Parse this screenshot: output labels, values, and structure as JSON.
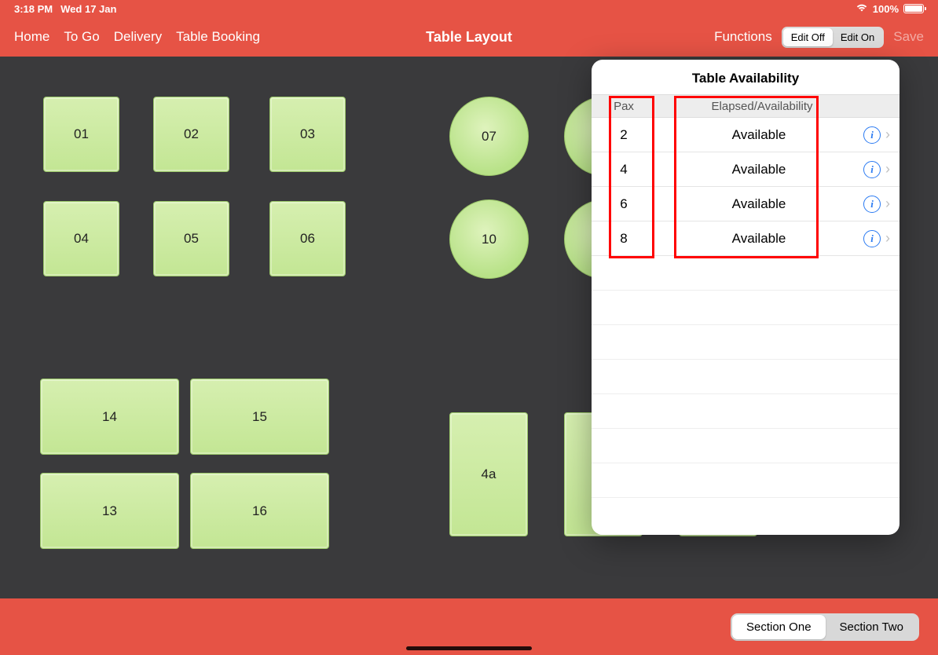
{
  "status": {
    "time": "3:18 PM",
    "date": "Wed 17 Jan",
    "battery": "100%"
  },
  "nav": {
    "home": "Home",
    "togo": "To Go",
    "delivery": "Delivery",
    "booking": "Table Booking",
    "title": "Table Layout",
    "functions": "Functions",
    "edit_off": "Edit Off",
    "edit_on": "Edit On",
    "save": "Save"
  },
  "tables": {
    "t01": "01",
    "t02": "02",
    "t03": "03",
    "t04": "04",
    "t05": "05",
    "t06": "06",
    "t07": "07",
    "t10": "10",
    "t14": "14",
    "t15": "15",
    "t13": "13",
    "t16": "16",
    "t4a": "4a"
  },
  "popover": {
    "title": "Table Availability",
    "col_pax": "Pax",
    "col_status": "Elapsed/Availability",
    "rows": [
      {
        "pax": "2",
        "status": "Available"
      },
      {
        "pax": "4",
        "status": "Available"
      },
      {
        "pax": "6",
        "status": "Available"
      },
      {
        "pax": "8",
        "status": "Available"
      }
    ]
  },
  "sections": {
    "one": "Section One",
    "two": "Section Two"
  }
}
